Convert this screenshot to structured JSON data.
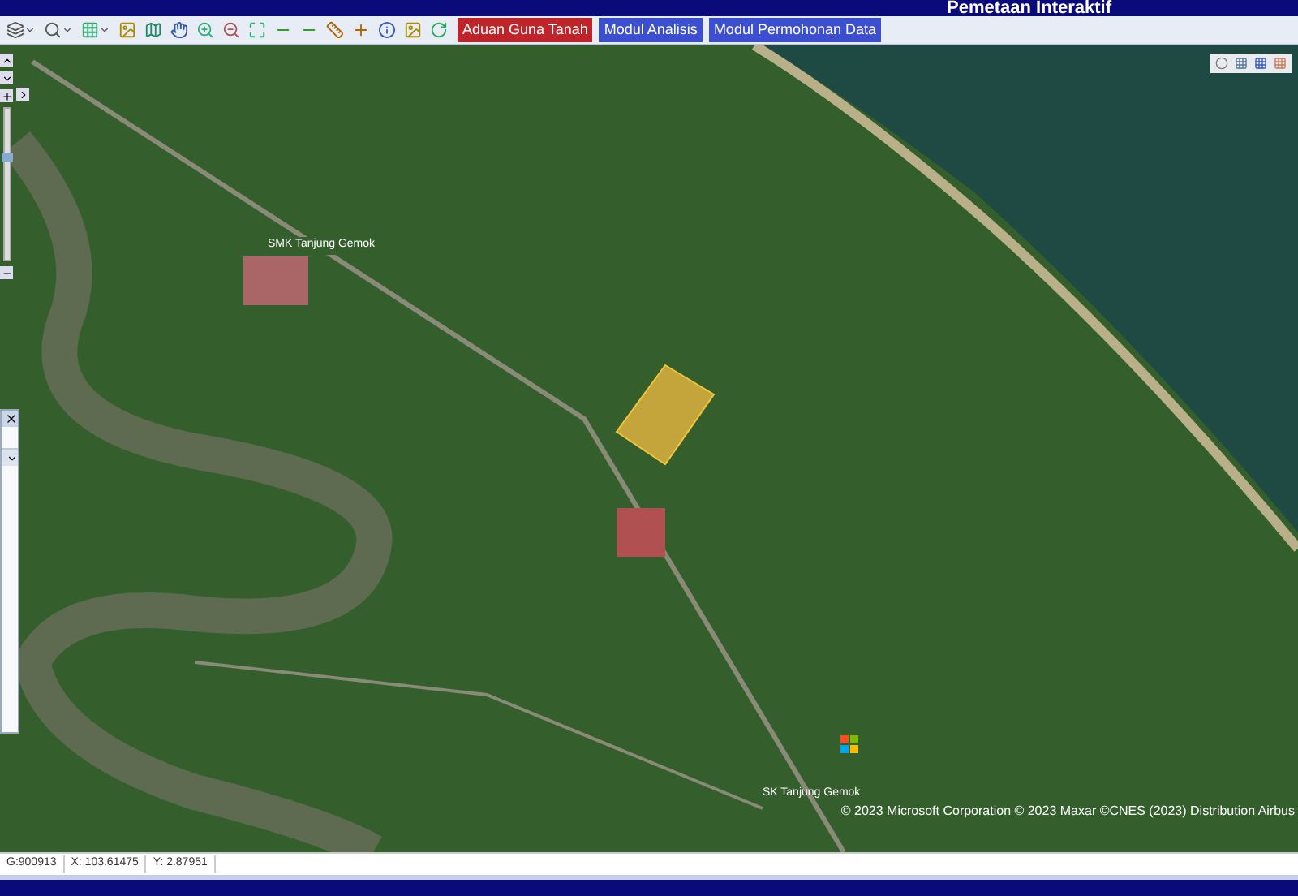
{
  "window": {
    "title": "Pemetaan Interaktif"
  },
  "toolbar": {
    "modules": [
      {
        "label": "Aduan Guna Tanah",
        "color": "#c0242b"
      },
      {
        "label": "Modul Analisis",
        "color": "#3b4fd0"
      },
      {
        "label": "Modul Permohonan Data",
        "color": "#3b4fd0"
      }
    ]
  },
  "zoom_slider": {
    "level": 0.65
  },
  "map": {
    "labels": [
      {
        "text": "SMK Tanjung Gemok"
      },
      {
        "text": "SK Tanjung Gemok"
      }
    ],
    "attribution": "© 2023 Microsoft Corporation © 2023 Maxar ©CNES (2023) Distribution Airbus"
  },
  "status_bar": {
    "items": [
      "G:900913",
      "X: 103.61475",
      "Y: 2.87951"
    ]
  }
}
